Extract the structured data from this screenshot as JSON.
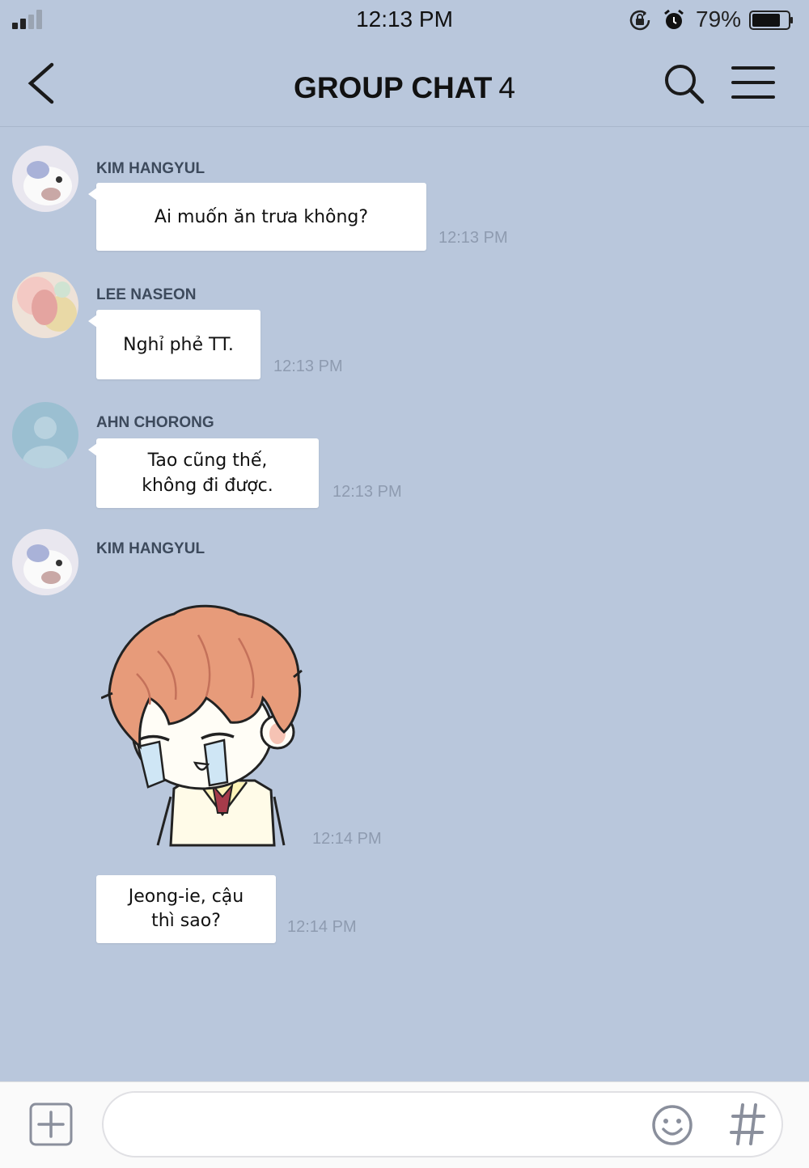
{
  "status_bar": {
    "time": "12:13 PM",
    "battery_percent": "79%",
    "battery_level": 0.79,
    "signal_bars": 2
  },
  "header": {
    "title": "GROUP CHAT",
    "member_count": "4"
  },
  "messages": [
    {
      "sender": "KIM HANGYUL",
      "text": "Ai muốn ăn trưa không?",
      "time": "12:13 PM"
    },
    {
      "sender": "LEE NASEON",
      "text": "Nghỉ phẻ TT.",
      "time": "12:13 PM"
    },
    {
      "sender": "AHN CHORONG",
      "text": "Tao cũng thế,\nkhông đi được.",
      "time": "12:13 PM"
    },
    {
      "sender": "KIM HANGYUL",
      "sticker": "crying-boy-sticker",
      "time": "12:14 PM"
    },
    {
      "text": "Jeong-ie, cậu\nthì sao?",
      "time": "12:14 PM"
    }
  ],
  "icons": {
    "back": "back-chevron-icon",
    "search": "search-icon",
    "menu": "hamburger-menu-icon",
    "add": "plus-icon",
    "emoji": "smiley-icon",
    "hashtag": "hashtag-icon"
  },
  "colors": {
    "background": "#b9c7dc",
    "bubble": "#ffffff",
    "sender_name": "#3d4a5c",
    "timestamp": "#8e9bb0"
  }
}
